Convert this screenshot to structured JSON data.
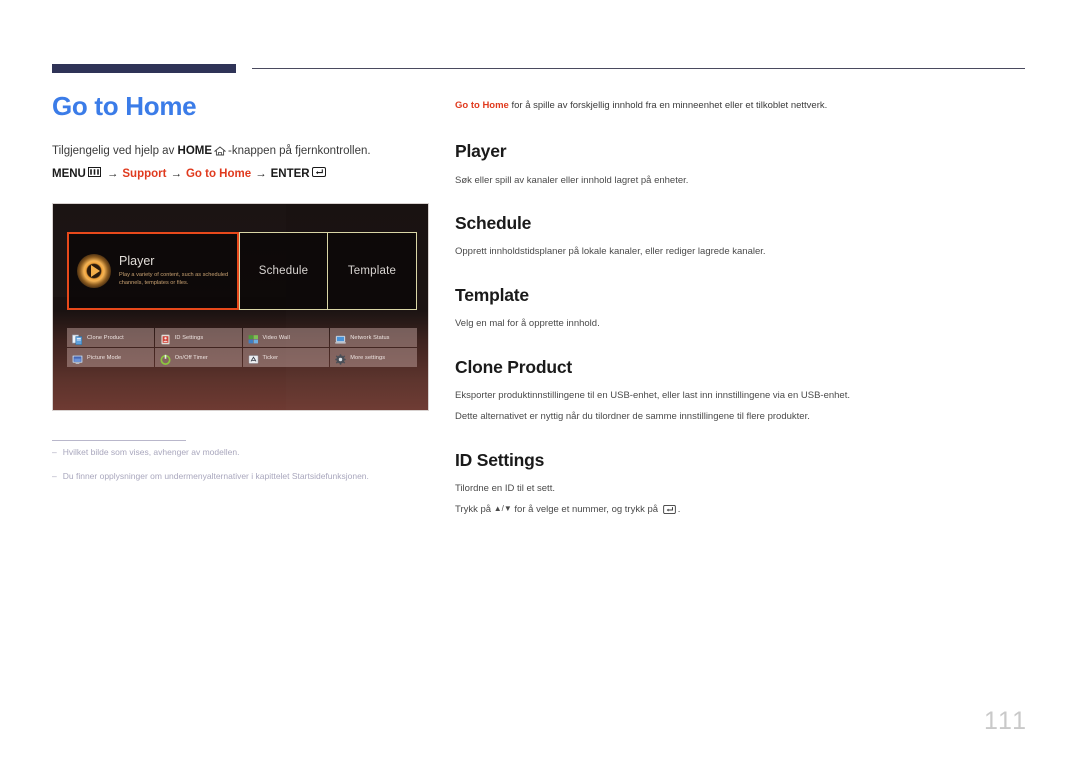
{
  "header": {
    "rule_color": "#2f3357",
    "accent_blue": "#3b7ce8",
    "accent_red": "#e03a1e"
  },
  "left": {
    "page_title": "Go to Home",
    "availability_prefix": "Tilgjengelig ved hjelp av ",
    "availability_bold": "HOME",
    "availability_suffix": "-knappen på fjernkontrollen.",
    "home_icon": "home-icon",
    "menu_path": {
      "menu_label": "MENU",
      "menu_icon": "menu-bars-icon",
      "arrow": "→",
      "step1": "Support",
      "step2": "Go to Home",
      "enter_label": "ENTER",
      "enter_icon": "enter-key-icon"
    },
    "footnotes": [
      {
        "dash": "–",
        "text": "Hvilket bilde som vises, avhenger av modellen."
      },
      {
        "dash": "–",
        "text": "Du finner opplysninger om undermenyalternativer i kapittelet Startsidefunksjonen."
      }
    ]
  },
  "tv_screenshot": {
    "tiles": [
      {
        "id": "player",
        "label": "Player",
        "description": "Play a variety of content, such as scheduled channels, templates or files.",
        "selected": true,
        "highlight_color": "#e8491b",
        "icon": "play-circle-icon"
      },
      {
        "id": "schedule",
        "label": "Schedule",
        "selected": false
      },
      {
        "id": "template",
        "label": "Template",
        "selected": false
      }
    ],
    "grid_items": [
      {
        "label": "Clone Product",
        "icon": "clone-product-icon",
        "color": "#dfe7f2"
      },
      {
        "label": "ID Settings",
        "icon": "id-card-icon",
        "color": "#d4564a"
      },
      {
        "label": "Video Wall",
        "icon": "video-wall-icon",
        "color": "#5fa83e"
      },
      {
        "label": "Network Status",
        "icon": "network-status-icon",
        "color": "#4a8fd4"
      },
      {
        "label": "Picture Mode",
        "icon": "picture-mode-icon",
        "color": "#5b7fc4"
      },
      {
        "label": "On/Off Timer",
        "icon": "timer-icon",
        "color": "#8cc63f"
      },
      {
        "label": "Ticker",
        "icon": "ticker-icon",
        "color": "#e8e8e8"
      },
      {
        "label": "More settings",
        "icon": "gear-icon",
        "color": "#4d4d4d"
      }
    ]
  },
  "right": {
    "intro_bold": "Go to Home",
    "intro_rest": " for å spille av forskjellig innhold fra en minneenhet eller et tilkoblet nettverk.",
    "sections": [
      {
        "heading": "Player",
        "paragraphs": [
          "Søk eller spill av kanaler eller innhold lagret på enheter."
        ]
      },
      {
        "heading": "Schedule",
        "paragraphs": [
          "Opprett innholdstidsplaner på lokale kanaler, eller rediger lagrede kanaler."
        ]
      },
      {
        "heading": "Template",
        "paragraphs": [
          "Velg en mal for å opprette innhold."
        ]
      },
      {
        "heading": "Clone Product",
        "paragraphs": [
          "Eksporter produktinnstillingene til en USB-enhet, eller last inn innstillingene via en USB-enhet.",
          "Dette alternativet er nyttig når du tilordner de samme innstillingene til flere produkter."
        ]
      },
      {
        "heading": "ID Settings",
        "paragraphs": [
          "Tilordne en ID til et sett."
        ],
        "final_line_prefix": "Trykk på ",
        "final_line_arrows": "▲/▼",
        "final_line_mid": " for å velge et nummer, og trykk på ",
        "final_line_icon": "enter-key-icon",
        "final_line_suffix": "."
      }
    ]
  },
  "footer": {
    "page_number": "111"
  }
}
